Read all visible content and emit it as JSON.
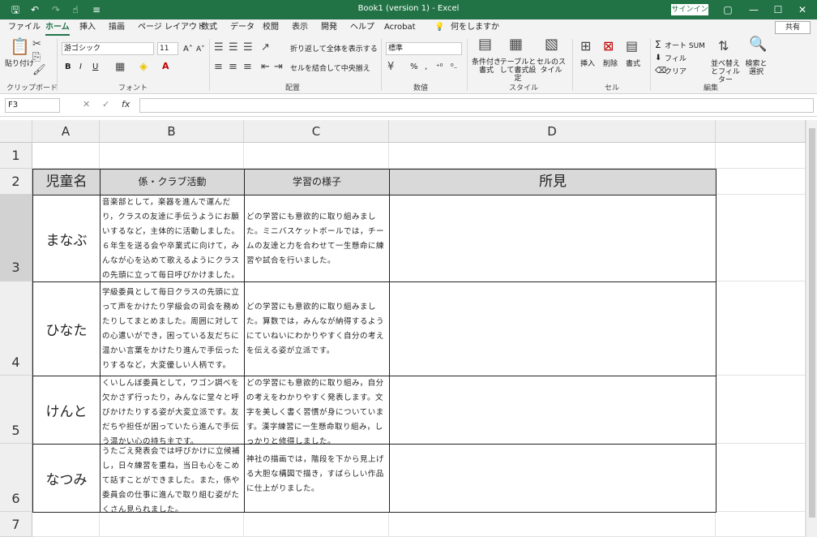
{
  "titlebar": {
    "title": "Book1 (version 1)  -  Excel",
    "signin": "サインイン",
    "restore_icon": "▢",
    "min_icon": "—",
    "max_icon": "☐",
    "close_icon": "✕",
    "qa_save": "🖫",
    "qa_undo": "↶",
    "qa_redo": "↷",
    "qa_touch": "☝",
    "qa_more": "≡"
  },
  "tabs": [
    "ファイル",
    "ホーム",
    "挿入",
    "描画",
    "ページ レイアウト",
    "数式",
    "データ",
    "校閲",
    "表示",
    "開発",
    "ヘルプ",
    "Acrobat"
  ],
  "tell_me": "何をしますか",
  "share": "共有",
  "ribbon": {
    "clipboard": {
      "paste": "貼り付け",
      "label": "クリップボード"
    },
    "font": {
      "name": "游ゴシック",
      "size": "11",
      "label": "フォント",
      "bold": "B",
      "italic": "I",
      "underline": "U"
    },
    "alignment": {
      "wrap": "折り返して全体を表示する",
      "merge": "セルを結合して中央揃え",
      "label": "配置"
    },
    "number": {
      "format": "標準",
      "percent": "%",
      "comma": ",",
      "label": "数値"
    },
    "styles": {
      "conditional": "条件付き書式",
      "table": "テーブルとして書式設定",
      "cell": "セルのスタイル",
      "label": "スタイル"
    },
    "cells": {
      "insert": "挿入",
      "delete": "削除",
      "format": "書式",
      "label": "セル"
    },
    "editing": {
      "autosum": "オート SUM",
      "fill": "フィル",
      "clear": "クリア",
      "sort": "並べ替えとフィルター",
      "find": "検索と選択",
      "label": "編集"
    }
  },
  "formula_bar": {
    "namebox": "F3",
    "cancel": "✕",
    "enter": "✓",
    "fx": "fx",
    "value": ""
  },
  "columns": [
    "A",
    "B",
    "C",
    "D"
  ],
  "rows": [
    "1",
    "2",
    "3",
    "4",
    "5",
    "6",
    "7"
  ],
  "table": {
    "headers": [
      "児童名",
      "係・クラブ活動",
      "学習の様子",
      "所見"
    ],
    "records": [
      {
        "name": "まなぶ",
        "club": "音楽部として，楽器を進んで運んだり，クラスの友達に手伝うようにお願いするなど，主体的に活動しました。６年生を送る会や卒業式に向けて，みんなが心を込めて歌えるようにクラスの先頭に立って毎日呼びかけました。",
        "study": "どの学習にも意欲的に取り組みました。ミニバスケットボールでは，チームの友達と力を合わせて一生懸命に練習や試合を行いました。",
        "note": ""
      },
      {
        "name": "ひなた",
        "club": "学級委員として毎日クラスの先頭に立って声をかけたり学級会の司会を務めたりしてまとめました。周囲に対しての心遣いができ，困っている友だちに温かい言葉をかけたり進んで手伝ったりするなど，大変優しい人柄です。",
        "study": "どの学習にも意欲的に取り組みました。算数では，みんなが納得するようにていねいにわかりやすく自分の考えを伝える姿が立派です。",
        "note": ""
      },
      {
        "name": "けんと",
        "club": "くいしんぼ委員として，ワゴン調べを欠かさず行ったり，みんなに堂々と呼びかけたりする姿が大変立派です。友だちや担任が困っていたら進んで手伝う温かい心の持ち主です。",
        "study": "どの学習にも意欲的に取り組み，自分の考えをわかりやすく発表します。文字を美しく書く習慣が身についています。漢字練習に一生懸命取り組み，しっかりと修得しました。",
        "note": ""
      },
      {
        "name": "なつみ",
        "club": "うたごえ発表会では呼びかけに立候補し，日々練習を重ね，当日も心をこめて話すことができました。また，係や委員会の仕事に進んで取り組む姿がたくさん見られました。",
        "study": "神社の描画では，階段を下から見上げる大胆な構図で描き，すばらしい作品に仕上がりました。",
        "note": ""
      }
    ]
  }
}
